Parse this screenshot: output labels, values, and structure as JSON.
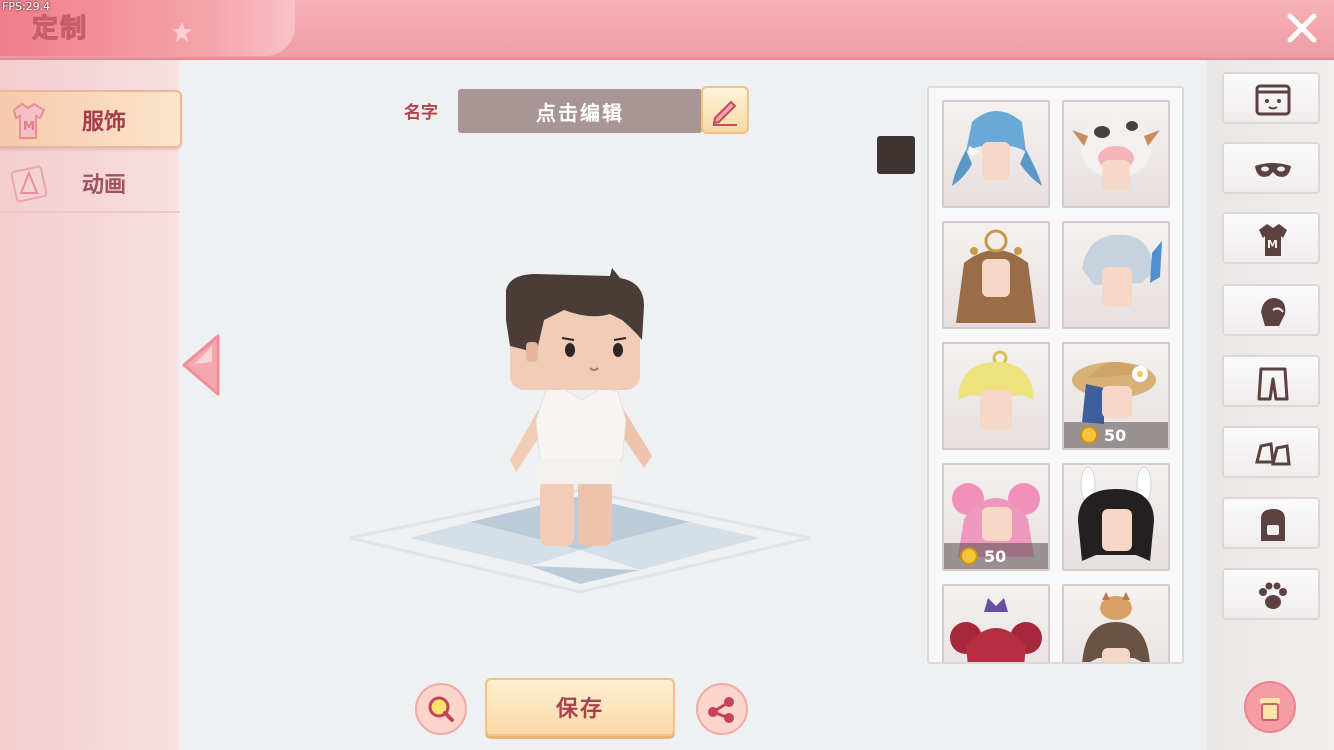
{
  "fps": "FPS:29.4",
  "header": {
    "title": "定制"
  },
  "sidebar": {
    "tabs": [
      {
        "label": "服饰",
        "icon": "shirt-icon",
        "active": true
      },
      {
        "label": "动画",
        "icon": "animation-icon",
        "active": false
      }
    ]
  },
  "name": {
    "label": "名字",
    "placeholder": "点击编辑"
  },
  "actions": {
    "save_label": "保存"
  },
  "selected_color": "#3d3331",
  "items": [
    {
      "name": "blue-twintail-hair",
      "price": null
    },
    {
      "name": "cow-hood-hair",
      "price": null
    },
    {
      "name": "brown-crown-long-hair",
      "price": null
    },
    {
      "name": "silver-hair-blue-wings",
      "price": null
    },
    {
      "name": "blonde-curly-hair",
      "price": null
    },
    {
      "name": "straw-hat-flower-hair",
      "price": "50"
    },
    {
      "name": "pink-buns-hair",
      "price": "50"
    },
    {
      "name": "bunny-ears-black-hair",
      "price": null
    },
    {
      "name": "red-buns-crown-hair",
      "price": null
    },
    {
      "name": "dog-on-head-hair",
      "price": null
    }
  ],
  "categories": [
    "face-icon",
    "mask-icon",
    "shirt-icon",
    "glove-icon",
    "pants-icon",
    "shoes-icon",
    "backpack-icon",
    "paw-icon"
  ],
  "colors": {
    "accent": "#a8424f",
    "header": "#f2a7ad",
    "coin": "#f3c53c"
  }
}
